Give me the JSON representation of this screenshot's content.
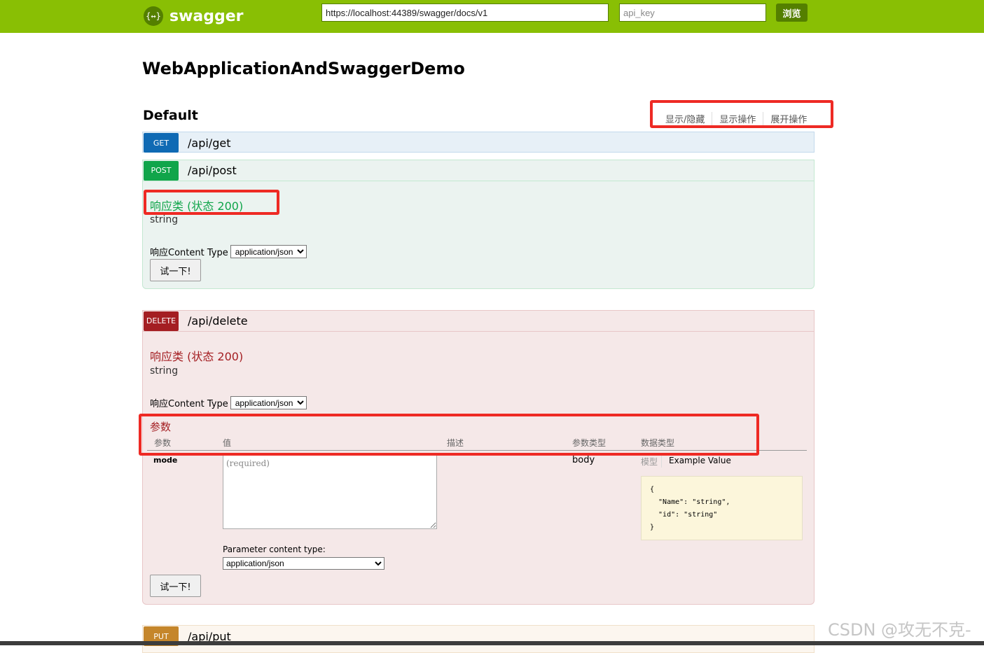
{
  "header": {
    "logo_icon": "{↔}",
    "logo_text": "swagger",
    "url_value": "https://localhost:44389/swagger/docs/v1",
    "api_key_placeholder": "api_key",
    "explore_label": "浏览"
  },
  "api_title": "WebApplicationAndSwaggerDemo",
  "section": {
    "title": "Default",
    "links": [
      "显示/隐藏",
      "显示操作",
      "展开操作"
    ]
  },
  "operations": {
    "get": {
      "verb": "GET",
      "path": "/api/get"
    },
    "post": {
      "verb": "POST",
      "path": "/api/post",
      "response_title": "响应类 (状态 200)",
      "response_type": "string",
      "content_type_label": "响应Content Type",
      "content_type_value": "application/json",
      "try_label": "试一下!"
    },
    "delete": {
      "verb": "DELETE",
      "path": "/api/delete",
      "response_title": "响应类 (状态 200)",
      "response_type": "string",
      "content_type_label": "响应Content Type",
      "content_type_value": "application/json",
      "params_title": "参数",
      "params_headers": [
        "参数",
        "值",
        "描述",
        "参数类型",
        "数据类型"
      ],
      "param": {
        "name": "mode",
        "placeholder": "(required)",
        "param_type": "body",
        "model_tab": "模型",
        "example_tab": "Example Value",
        "example_json": "{\n  \"Name\": \"string\",\n  \"id\": \"string\"\n}"
      },
      "param_content_type_label": "Parameter content type:",
      "param_content_type_value": "application/json",
      "try_label": "试一下!"
    },
    "put": {
      "verb": "PUT",
      "path": "/api/put"
    }
  },
  "watermark": "CSDN @攻无不克-",
  "colors": {
    "topbar": "#89bf04",
    "get": "#0f6ab4",
    "post": "#10a54a",
    "delete": "#a41e22",
    "put": "#c5862b",
    "highlight": "#ee2a24"
  }
}
